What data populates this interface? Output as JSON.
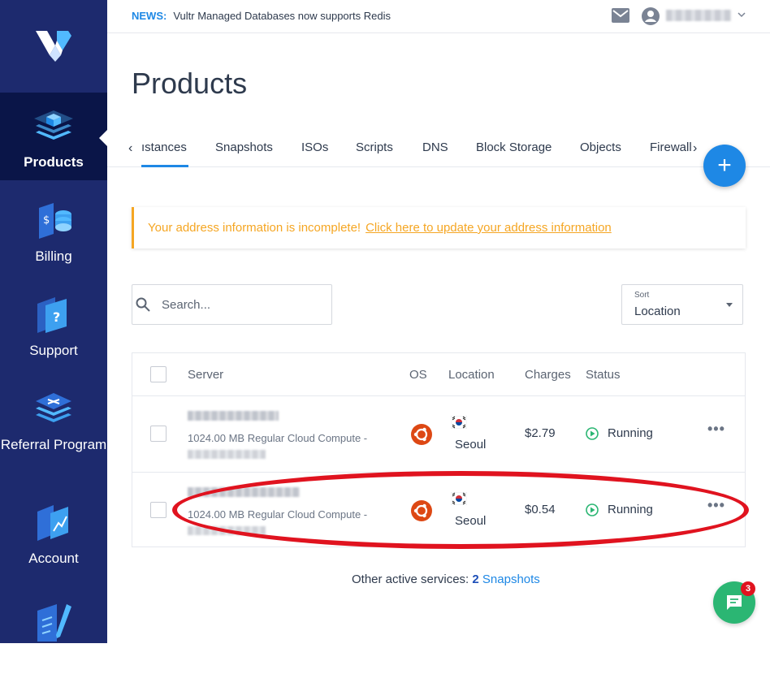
{
  "sidebar": {
    "items": [
      {
        "label": "Products",
        "icon": "layers-icon"
      },
      {
        "label": "Billing",
        "icon": "billing-icon"
      },
      {
        "label": "Support",
        "icon": "support-icon"
      },
      {
        "label": "Referral Program",
        "icon": "referral-icon"
      },
      {
        "label": "Account",
        "icon": "account-icon"
      },
      {
        "label": "",
        "icon": "document-edit-icon"
      }
    ],
    "active": "Products"
  },
  "topbar": {
    "news_tag": "NEWS:",
    "news_text": "Vultr Managed Databases now supports Redis"
  },
  "page": {
    "title": "Products"
  },
  "tabs": [
    {
      "label": "ıstances",
      "active": true
    },
    {
      "label": "Snapshots"
    },
    {
      "label": "ISOs"
    },
    {
      "label": "Scripts"
    },
    {
      "label": "DNS"
    },
    {
      "label": "Block Storage"
    },
    {
      "label": "Objects"
    },
    {
      "label": "Firewall"
    }
  ],
  "fab": {
    "label": "+"
  },
  "alert": {
    "text": "Your address information is incomplete!",
    "link": "Click here to update your address information"
  },
  "search": {
    "placeholder": "Search..."
  },
  "sort": {
    "label": "Sort",
    "value": "Location"
  },
  "table": {
    "headers": {
      "server": "Server",
      "os": "OS",
      "location": "Location",
      "charges": "Charges",
      "status": "Status"
    },
    "rows": [
      {
        "plan": "1024.00 MB Regular Cloud Compute -",
        "location": "Seoul",
        "charges": "$2.79",
        "status": "Running"
      },
      {
        "plan": "1024.00 MB Regular Cloud Compute -",
        "location": "Seoul",
        "charges": "$0.54",
        "status": "Running"
      }
    ]
  },
  "footer": {
    "other_label": "Other active services:",
    "count": "2",
    "link": "Snapshots"
  },
  "chat": {
    "badge": "3"
  },
  "colors": {
    "sidebar": "#1d2a6e",
    "sidebar_active": "#0a1548",
    "accent": "#1e88e5",
    "alert": "#f5a623",
    "running": "#2bb673",
    "ubuntu": "#dd4814",
    "highlight": "#e0131f"
  }
}
